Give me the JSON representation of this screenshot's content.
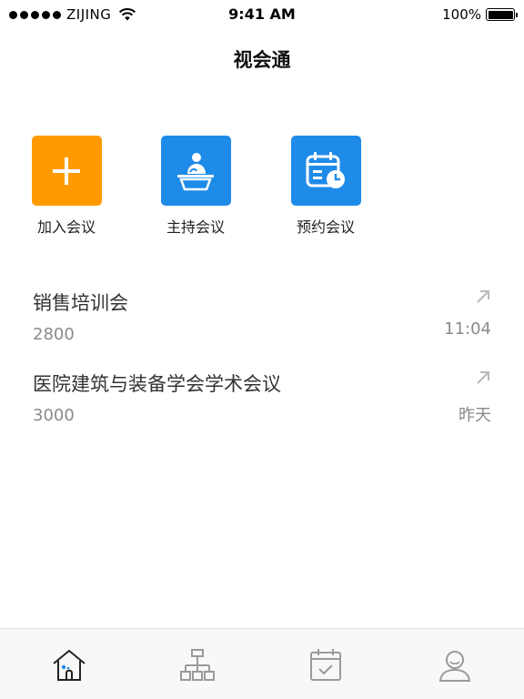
{
  "status_bar": {
    "carrier": "ZIJING",
    "time": "9:41 AM",
    "battery": "100%"
  },
  "nav": {
    "title": "视会通"
  },
  "actions": [
    {
      "label": "加入会议",
      "icon": "plus-icon",
      "color": "#fe9a00"
    },
    {
      "label": "主持会议",
      "icon": "host-podium-icon",
      "color": "#1f8be8"
    },
    {
      "label": "预约会议",
      "icon": "calendar-clock-icon",
      "color": "#1f8be8"
    }
  ],
  "meetings": [
    {
      "title": "销售培训会",
      "id": "2800",
      "time": "11:04"
    },
    {
      "title": "医院建筑与装备学会学术会议",
      "id": "3000",
      "time": "昨天"
    }
  ],
  "tabbar": {
    "tabs": [
      {
        "icon": "home-icon",
        "active": true
      },
      {
        "icon": "org-chart-icon",
        "active": false
      },
      {
        "icon": "calendar-check-icon",
        "active": false
      },
      {
        "icon": "user-icon",
        "active": false
      }
    ],
    "active_color": "#1f8be8",
    "inactive_color": "#9a9a9a"
  }
}
